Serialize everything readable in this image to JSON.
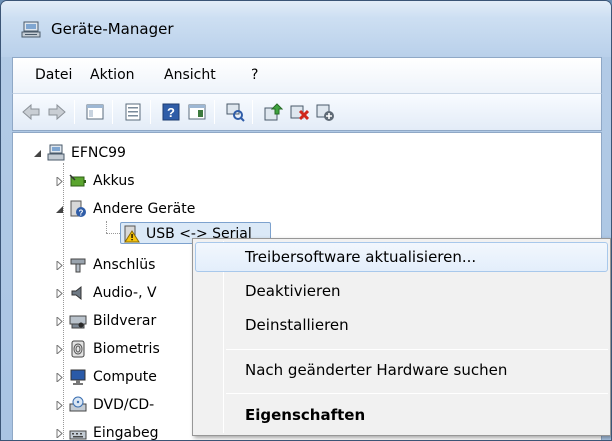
{
  "window": {
    "title": "Geräte-Manager",
    "title_icon": "device-manager-icon"
  },
  "menubar": {
    "items": [
      "Datei",
      "Aktion",
      "Ansicht",
      "?"
    ]
  },
  "toolbar": {
    "buttons": [
      {
        "name": "back",
        "icon": "back-arrow-icon"
      },
      {
        "name": "forward",
        "icon": "forward-arrow-icon"
      },
      {
        "name": "show-hide-console-tree",
        "icon": "console-tree-icon"
      },
      {
        "name": "properties",
        "icon": "properties-icon"
      },
      {
        "name": "help",
        "icon": "help-icon"
      },
      {
        "name": "show-action-pane",
        "icon": "action-pane-icon"
      },
      {
        "name": "scan-hardware",
        "icon": "scan-hardware-icon"
      },
      {
        "name": "update-driver",
        "icon": "update-driver-icon"
      },
      {
        "name": "uninstall",
        "icon": "uninstall-icon"
      },
      {
        "name": "disable",
        "icon": "disable-icon"
      }
    ]
  },
  "tree": {
    "root": {
      "label": "EFNC99",
      "icon": "computer-icon",
      "expanded": true
    },
    "nodes": [
      {
        "label": "Akkus",
        "icon": "battery-icon",
        "expanded": false
      },
      {
        "label": "Andere Geräte",
        "icon": "unknown-device-icon",
        "expanded": true
      },
      {
        "label": "USB <-> Serial",
        "icon": "warning-device-icon",
        "child": true,
        "selected": true
      },
      {
        "label": "Anschlüs",
        "icon": "port-icon",
        "expanded": false
      },
      {
        "label": "Audio-, V",
        "icon": "audio-icon",
        "expanded": false
      },
      {
        "label": "Bildverar",
        "icon": "imaging-icon",
        "expanded": false
      },
      {
        "label": "Biometris",
        "icon": "biometric-icon",
        "expanded": false
      },
      {
        "label": "Compute",
        "icon": "monitor-icon",
        "expanded": false
      },
      {
        "label": "DVD/CD-",
        "icon": "dvd-drive-icon",
        "expanded": false
      },
      {
        "label": "Eingabeg",
        "icon": "input-device-icon",
        "expanded": false
      }
    ]
  },
  "context_menu": {
    "items": [
      {
        "label": "Treibersoftware aktualisieren...",
        "highlighted": true
      },
      {
        "label": "Deaktivieren"
      },
      {
        "label": "Deinstallieren"
      },
      {
        "separator": true
      },
      {
        "label": "Nach geänderter Hardware suchen"
      },
      {
        "separator": true
      },
      {
        "label": "Eigenschaften",
        "bold": true
      }
    ]
  }
}
